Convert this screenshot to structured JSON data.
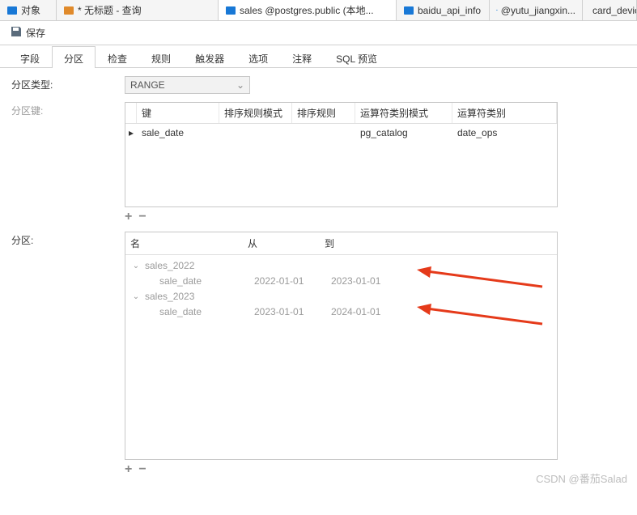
{
  "doc_tabs": {
    "t0": "对象",
    "t1": "* 无标题 - 查询",
    "t2": "sales @postgres.public (本地...",
    "t3": "baidu_api_info",
    "t4": "@yutu_jiangxin...",
    "t5": "card_devic"
  },
  "toolbar": {
    "save": "保存"
  },
  "subtabs": {
    "fields": "字段",
    "partition": "分区",
    "check": "检查",
    "rules": "规则",
    "triggers": "触发器",
    "options": "选项",
    "comment": "注释",
    "sql": "SQL 预览"
  },
  "labels": {
    "type": "分区类型:",
    "key": "分区键:",
    "parts": "分区:"
  },
  "select": {
    "type_val": "RANGE"
  },
  "grid": {
    "head": {
      "key": "键",
      "collate_mode": "排序规则模式",
      "collate": "排序规则",
      "opclass_mode": "运算符类别模式",
      "opclass": "运算符类别"
    },
    "row0": {
      "key": "sale_date",
      "collate_mode": "",
      "collate": "",
      "opclass_mode": "pg_catalog",
      "opclass": "date_ops"
    }
  },
  "partgrid": {
    "head": {
      "name": "名",
      "from": "从",
      "to": "到"
    },
    "n0": {
      "name": "sales_2022"
    },
    "l0": {
      "name": "sale_date",
      "from": "2022-01-01",
      "to": "2023-01-01"
    },
    "n1": {
      "name": "sales_2023"
    },
    "l1": {
      "name": "sale_date",
      "from": "2023-01-01",
      "to": "2024-01-01"
    }
  },
  "glyph": {
    "plus": "+",
    "minus": "−",
    "chev": "⌄",
    "chev_open": "⌄",
    "marker": "▸"
  },
  "watermark": "CSDN @番茄Salad"
}
